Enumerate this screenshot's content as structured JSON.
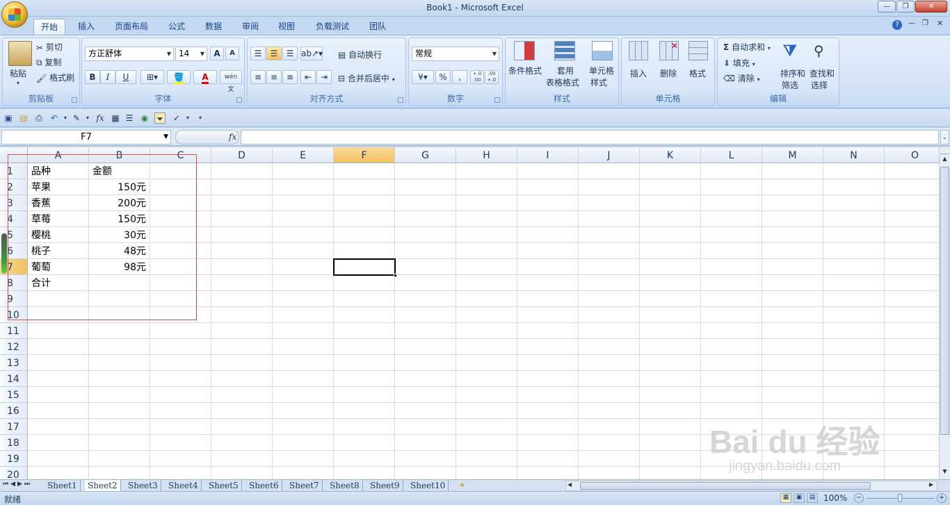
{
  "window": {
    "title": "Book1 - Microsoft Excel",
    "minimize": "—",
    "restore": "❐",
    "close": "✕"
  },
  "tabs": [
    "开始",
    "插入",
    "页面布局",
    "公式",
    "数据",
    "审阅",
    "视图",
    "负载测试",
    "团队"
  ],
  "ribbon": {
    "clipboard": {
      "label": "剪贴板",
      "paste": "粘贴",
      "cut": "剪切",
      "copy": "复制",
      "format_painter": "格式刷"
    },
    "font": {
      "label": "字体",
      "font_name": "方正舒体",
      "font_size": "14",
      "bold": "B",
      "italic": "I",
      "underline": "U",
      "grow": "A",
      "shrink": "A",
      "font_color_letter": "A",
      "phonetic": "wén 文"
    },
    "alignment": {
      "label": "对齐方式",
      "wrap_text": "自动换行",
      "merge_center": "合并后居中"
    },
    "number": {
      "label": "数字",
      "format": "常规",
      "percent": "%",
      "comma": ",",
      "inc_decimal": "+.0 .00",
      "dec_decimal": ".00 +.0"
    },
    "styles": {
      "label": "样式",
      "conditional": "条件格式",
      "table_format_1": "套用",
      "table_format_2": "表格格式",
      "cell_styles_1": "单元格",
      "cell_styles_2": "样式"
    },
    "cells": {
      "label": "单元格",
      "insert": "插入",
      "delete": "删除",
      "format": "格式"
    },
    "editing": {
      "label": "编辑",
      "autosum": "自动求和",
      "fill": "填充",
      "clear": "清除",
      "sort_1": "排序和",
      "sort_2": "筛选",
      "find_1": "查找和",
      "find_2": "选择"
    }
  },
  "formula_bar": {
    "name_box": "F7",
    "fx": "fx",
    "value": ""
  },
  "columns": [
    "A",
    "B",
    "C",
    "D",
    "E",
    "F",
    "G",
    "H",
    "I",
    "J",
    "K",
    "L",
    "M",
    "N",
    "O"
  ],
  "rows": [
    "1",
    "2",
    "3",
    "4",
    "5",
    "6",
    "7",
    "8",
    "9",
    "10",
    "11",
    "12",
    "13",
    "14",
    "15",
    "16",
    "17",
    "18",
    "19",
    "20"
  ],
  "selected_column": "F",
  "selected_row": "7",
  "cells": [
    {
      "a": "品种",
      "b": "金额"
    },
    {
      "a": "苹果",
      "b": "150元"
    },
    {
      "a": "香蕉",
      "b": "200元"
    },
    {
      "a": "草莓",
      "b": "150元"
    },
    {
      "a": "樱桃",
      "b": "30元"
    },
    {
      "a": "桃子",
      "b": "48元"
    },
    {
      "a": "葡萄",
      "b": "98元"
    },
    {
      "a": "合计",
      "b": ""
    }
  ],
  "sheet_tabs": [
    "Sheet1",
    "Sheet2",
    "Sheet3",
    "Sheet4",
    "Sheet5",
    "Sheet6",
    "Sheet7",
    "Sheet8",
    "Sheet9",
    "Sheet10"
  ],
  "active_sheet": "Sheet2",
  "status": {
    "ready": "就绪",
    "zoom": "100%"
  },
  "watermark": {
    "brand": "Bai du 经验",
    "url": "jingyan.baidu.com"
  }
}
